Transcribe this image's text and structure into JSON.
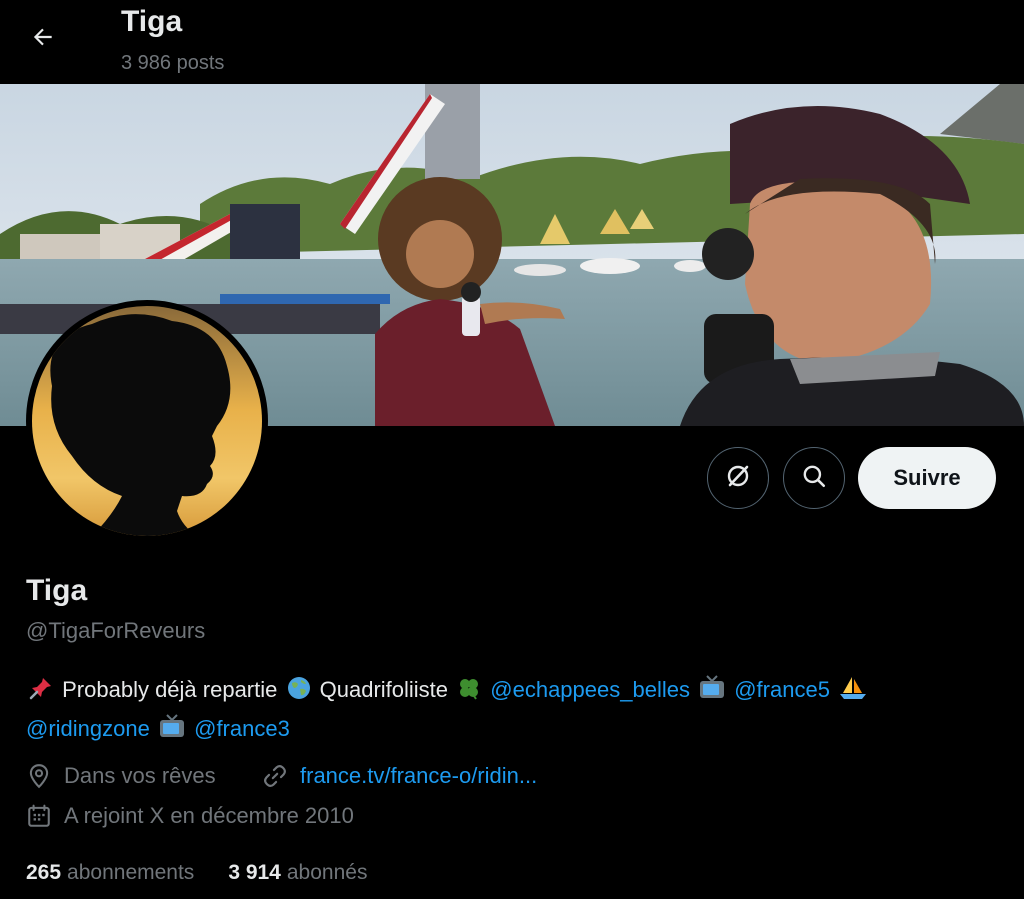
{
  "header": {
    "title": "Tiga",
    "post_count": "3 986 posts"
  },
  "profile": {
    "name": "Tiga",
    "handle": "@TigaForReveurs",
    "follow_label": "Suivre",
    "bio": {
      "text_1": "Probably déjà repartie",
      "text_2": "Quadrifoliiste",
      "mention_1": "@echappees_belles",
      "mention_2": "@france5",
      "mention_3": "@ridingzone",
      "mention_4": "@france3"
    },
    "location": "Dans vos rêves",
    "website": "france.tv/france-o/ridin...",
    "joined": "A rejoint X en décembre 2010",
    "following_count": "265",
    "following_label": "abonnements",
    "followers_count": "3 914",
    "followers_label": "abonnés"
  },
  "icons": {
    "back": "arrow-left-icon",
    "grok": "grok-icon",
    "search": "search-icon",
    "location": "location-pin-icon",
    "link": "link-icon",
    "calendar": "calendar-icon",
    "bio_emojis": [
      "pushpin-emoji",
      "globe-emoji",
      "four-leaf-clover-emoji",
      "television-emoji",
      "sailboat-emoji",
      "television-emoji"
    ]
  },
  "colors": {
    "background": "#000000",
    "text_primary": "#e7e9ea",
    "text_secondary": "#71767b",
    "link": "#1d9bf0",
    "follow_button_bg": "#eff3f4"
  }
}
